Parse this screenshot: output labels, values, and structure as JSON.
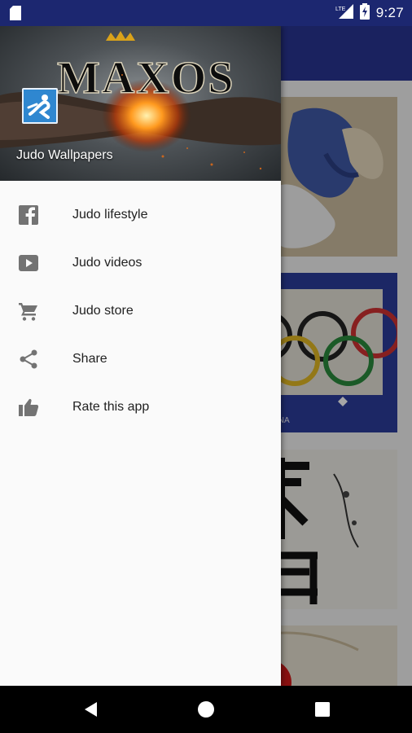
{
  "status_bar": {
    "time": "9:27",
    "icons": [
      "sd-card-icon",
      "signal-lte-icon",
      "battery-charging-icon"
    ],
    "background": "#1c2770"
  },
  "app": {
    "toolbar_color": "#293593"
  },
  "drawer": {
    "header": {
      "logo_text": "MAXOS",
      "title": "Judo Wallpapers",
      "app_icon": "judo-throw-icon"
    },
    "items": [
      {
        "label": "Judo lifestyle",
        "icon": "facebook-icon"
      },
      {
        "label": "Judo videos",
        "icon": "youtube-play-icon"
      },
      {
        "label": "Judo store",
        "icon": "shopping-cart-icon"
      },
      {
        "label": "Share",
        "icon": "share-icon"
      },
      {
        "label": "Rate this app",
        "icon": "thumbs-up-icon"
      }
    ]
  },
  "tiles": [
    {
      "name": "judo-gi-photo"
    },
    {
      "name": "olympic-rings-photo",
      "caption": "DO ARENA"
    },
    {
      "name": "judo-calligraphy-photo"
    },
    {
      "name": "dojo-photo"
    }
  ],
  "nav_bar": {
    "buttons": [
      "back-button",
      "home-button",
      "recents-button"
    ]
  }
}
